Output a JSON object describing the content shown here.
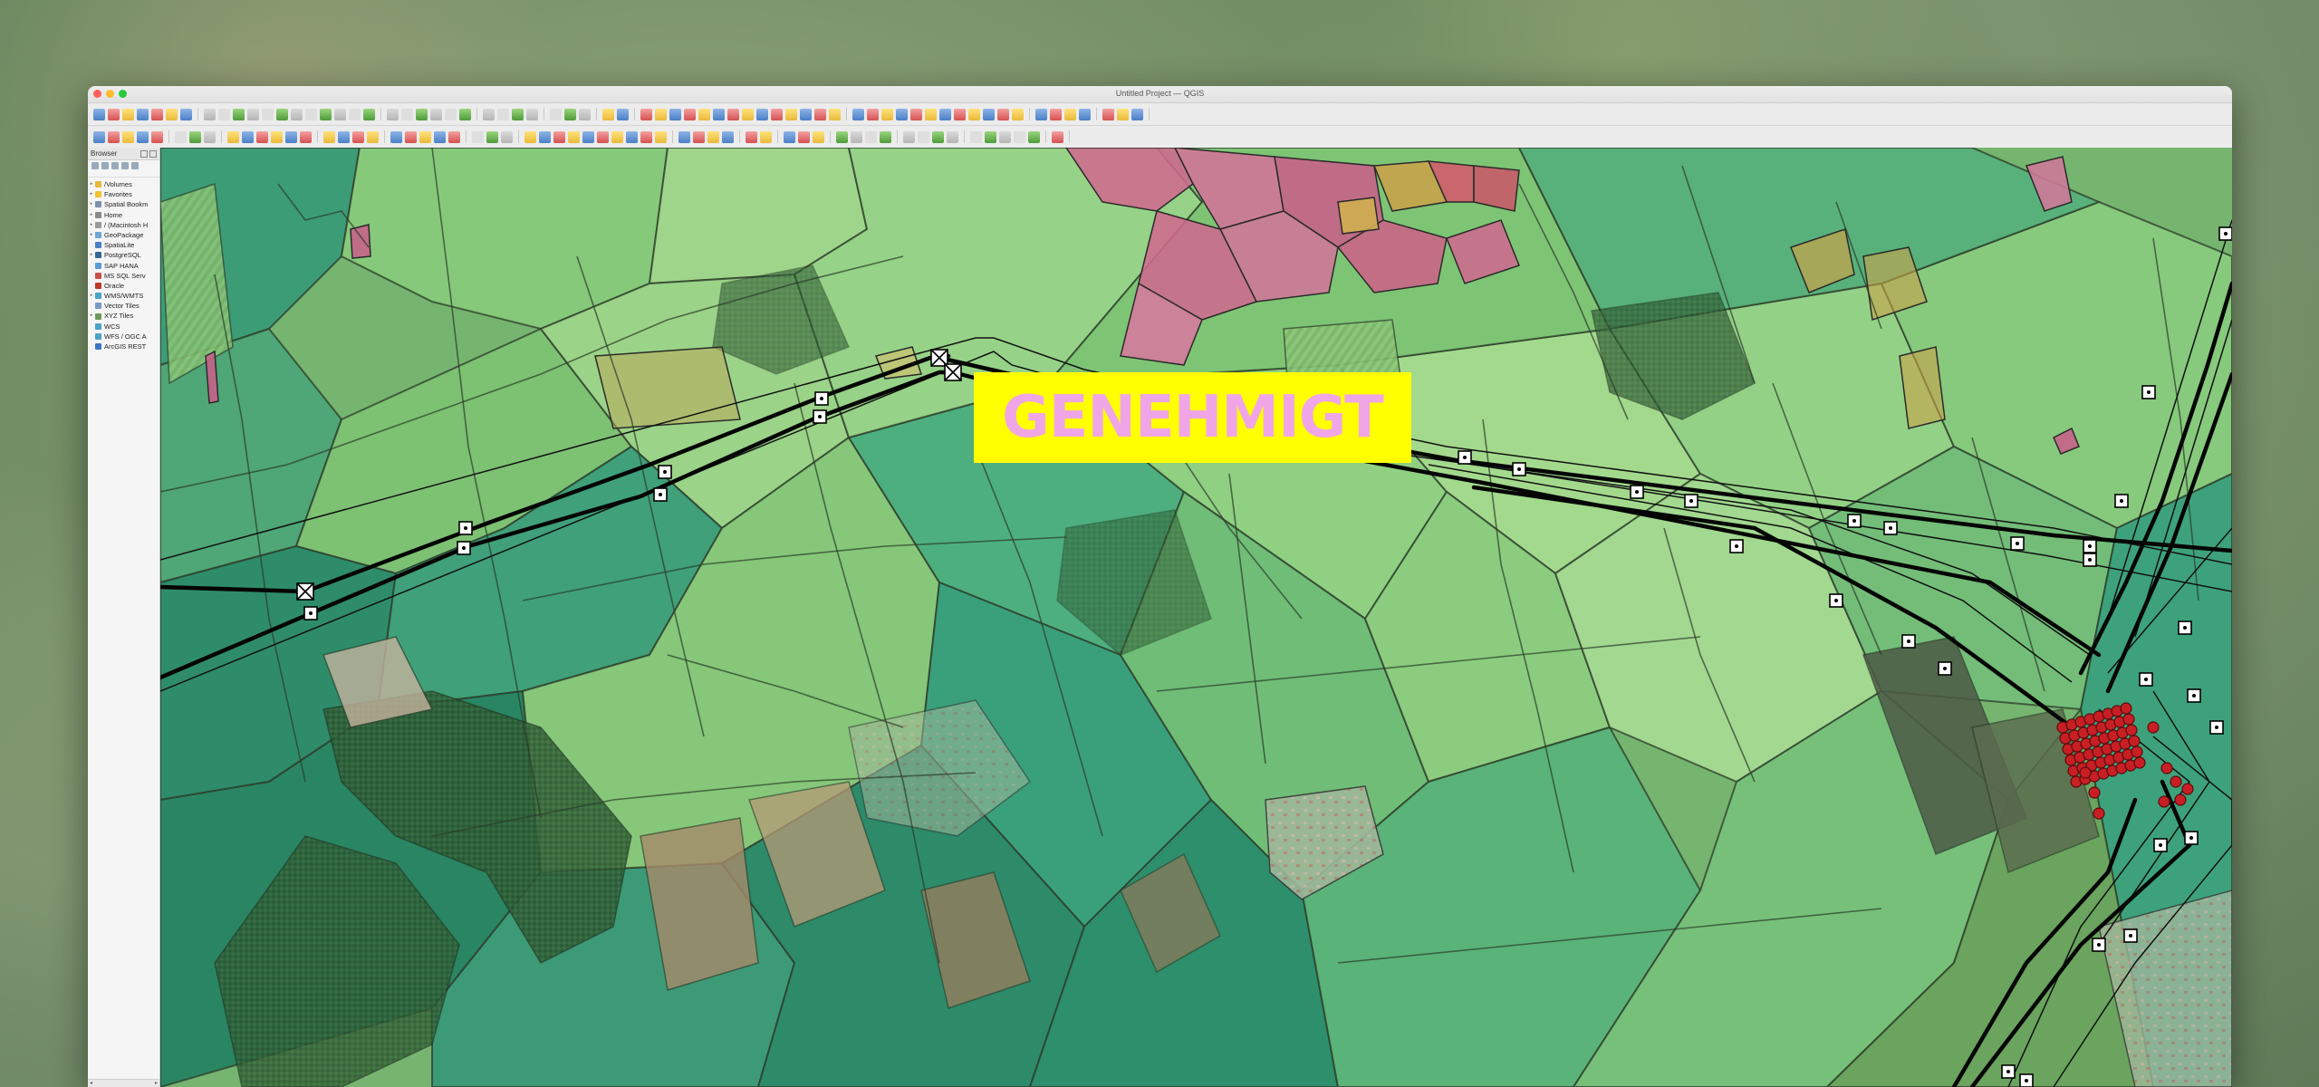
{
  "window": {
    "title": "Untitled Project — QGIS"
  },
  "browser_panel": {
    "title": "Browser",
    "items": [
      {
        "label": "/Volumes",
        "icon": "folder-icon",
        "color": "#e9b93a",
        "expandable": true
      },
      {
        "label": "Favorites",
        "icon": "star-icon",
        "color": "#f2c230",
        "expandable": true
      },
      {
        "label": "Spatial Bookm",
        "icon": "bookmark-icon",
        "color": "#7a8fb0",
        "expandable": true
      },
      {
        "label": "Home",
        "icon": "home-icon",
        "color": "#8a8a8a",
        "expandable": true
      },
      {
        "label": "/ (Macintosh H",
        "icon": "disk-icon",
        "color": "#9a9a9a",
        "expandable": true
      },
      {
        "label": "GeoPackage",
        "icon": "geopackage-icon",
        "color": "#6aa6d8",
        "expandable": true
      },
      {
        "label": "SpatiaLite",
        "icon": "spatialite-icon",
        "color": "#4a7fc6",
        "expandable": false
      },
      {
        "label": "PostgreSQL",
        "icon": "postgresql-icon",
        "color": "#336791",
        "expandable": true
      },
      {
        "label": "SAP HANA",
        "icon": "sap-hana-icon",
        "color": "#5b9bd5",
        "expandable": false
      },
      {
        "label": "MS SQL Serv",
        "icon": "mssql-icon",
        "color": "#c8524a",
        "expandable": false
      },
      {
        "label": "Oracle",
        "icon": "oracle-icon",
        "color": "#c0392b",
        "expandable": false
      },
      {
        "label": "WMS/WMTS",
        "icon": "wms-icon",
        "color": "#4aa3c8",
        "expandable": true
      },
      {
        "label": "Vector Tiles",
        "icon": "vector-tiles-icon",
        "color": "#7a9ac6",
        "expandable": false
      },
      {
        "label": "XYZ Tiles",
        "icon": "xyz-tiles-icon",
        "color": "#6a9a5a",
        "expandable": true
      },
      {
        "label": "WCS",
        "icon": "wcs-icon",
        "color": "#4aa3c8",
        "expandable": false
      },
      {
        "label": "WFS / OGC A",
        "icon": "wfs-icon",
        "color": "#4aa3c8",
        "expandable": false
      },
      {
        "label": "ArcGIS REST",
        "icon": "arcgis-icon",
        "color": "#3c78c8",
        "expandable": false
      }
    ]
  },
  "map": {
    "stamp_text": "GENEHMIGT",
    "stamp_bg": "#ffff00",
    "stamp_fg": "#f0a6e6"
  }
}
